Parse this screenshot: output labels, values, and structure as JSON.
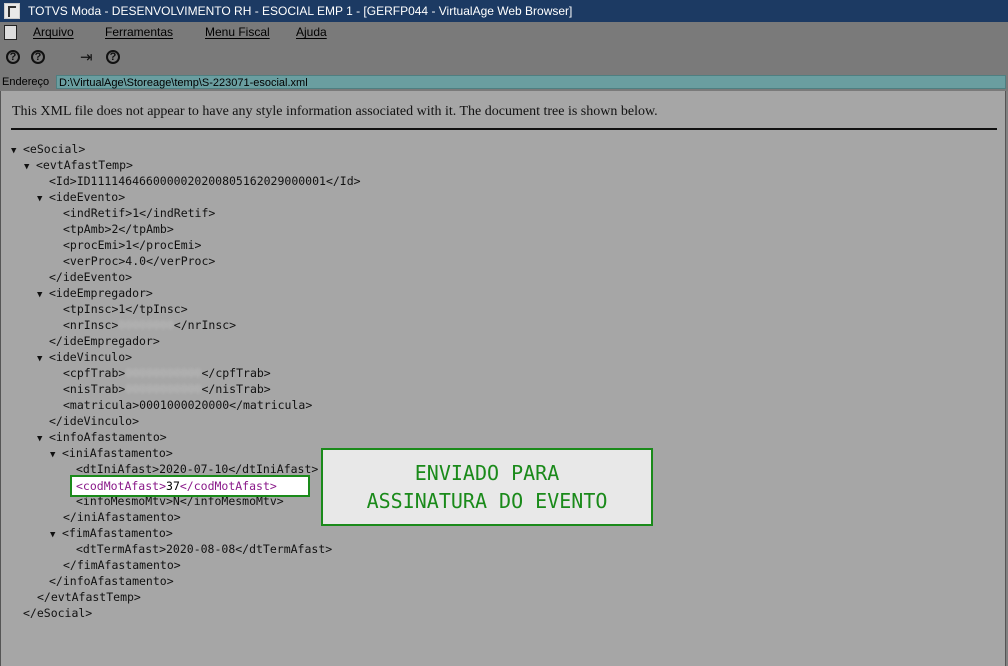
{
  "window": {
    "title": "TOTVS Moda - DESENVOLVIMENTO RH - ESOCIAL EMP 1 - [GERFP044 - VirtualAge Web Browser]"
  },
  "menu": {
    "items": [
      "Arquivo",
      "Ferramentas",
      "Menu Fiscal",
      "Ajuda"
    ]
  },
  "address": {
    "label": "Endereço",
    "value": "D:\\VirtualAge\\Storeage\\temp\\S-223071-esocial.xml"
  },
  "content": {
    "notice": "This XML file does not appear to have any style information associated with it. The document tree is shown below.",
    "lines": [
      "<eSocial>",
      "<evtAfastTemp>",
      "<Id>ID1111464660000020200805162029000001</Id>",
      "<ideEvento>",
      "<indRetif>1</indRetif>",
      "<tpAmb>2</tpAmb>",
      "<procEmi>1</procEmi>",
      "<verProc>4.0</verProc>",
      "</ideEvento>",
      "<ideEmpregador>",
      "<tpInsc>1</tpInsc>",
      "<nrInsc>",
      "</ideEmpregador>",
      "<ideVinculo>",
      "<cpfTrab>",
      "<nisTrab>",
      "<matricula>0001000020000</matricula>",
      "</ideVinculo>",
      "<infoAfastamento>",
      "<iniAfastamento>",
      "<dtIniAfast>2020-07-10</dtIniAfast>",
      "<infoMesmoMtv>N</infoMesmoMtv>",
      "</iniAfastamento>",
      "<fimAfastamento>",
      "<dtTermAfast>2020-08-08</dtTermAfast>",
      "</fimAfastamento>",
      "</infoAfastamento>",
      "</evtAfastTemp>",
      "</eSocial>"
    ],
    "nrInsc_close": "</nrInsc>",
    "cpfTrab_close": "</cpfTrab>",
    "nisTrab_close": "</nisTrab>",
    "highlight": {
      "open": "<codMotAfast>",
      "value": "37",
      "close": "</codMotAfast>"
    },
    "callout": {
      "line1": "ENVIADO PARA",
      "line2": "ASSINATURA DO EVENTO"
    }
  },
  "colors": {
    "callout_border": "#1a8a1a",
    "tag_purple": "#8a1a8a",
    "titlebar": "#1c3a63"
  }
}
